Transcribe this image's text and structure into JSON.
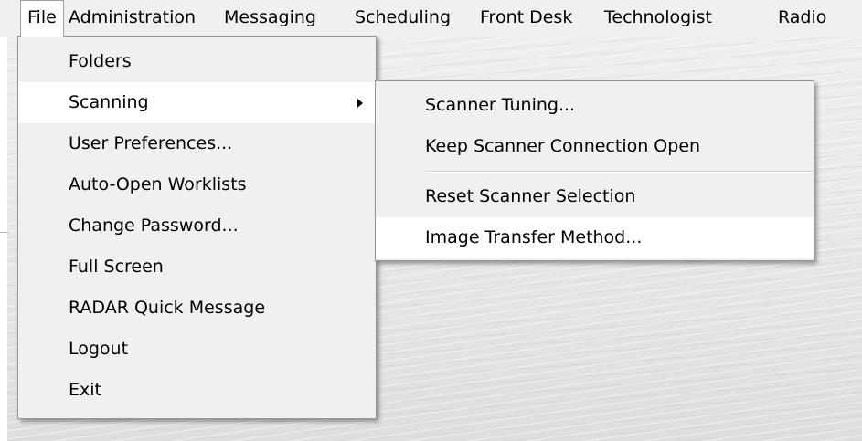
{
  "menubar": {
    "items": [
      {
        "label": "File",
        "active": true
      },
      {
        "label": "Administration"
      },
      {
        "label": "Messaging"
      },
      {
        "label": "Scheduling"
      },
      {
        "label": "Front Desk"
      },
      {
        "label": "Technologist"
      },
      {
        "label": "Radio"
      }
    ]
  },
  "file_menu": {
    "items": [
      {
        "label": "Folders"
      },
      {
        "label": "Scanning",
        "has_submenu": true,
        "highlighted": true
      },
      {
        "label": "User Preferences..."
      },
      {
        "label": "Auto-Open Worklists"
      },
      {
        "label": "Change Password..."
      },
      {
        "label": "Full Screen"
      },
      {
        "label": "RADAR Quick Message"
      },
      {
        "label": "Logout"
      },
      {
        "label": "Exit"
      }
    ]
  },
  "scanning_submenu": {
    "items": [
      {
        "label": "Scanner Tuning..."
      },
      {
        "label": "Keep Scanner Connection Open"
      },
      {
        "label": "Reset Scanner Selection"
      },
      {
        "label": "Image Transfer Method...",
        "highlighted": true
      }
    ]
  },
  "colors": {
    "menu_background": "#f0f0f0",
    "highlight_background": "#ffffff",
    "menu_border": "#979797"
  }
}
